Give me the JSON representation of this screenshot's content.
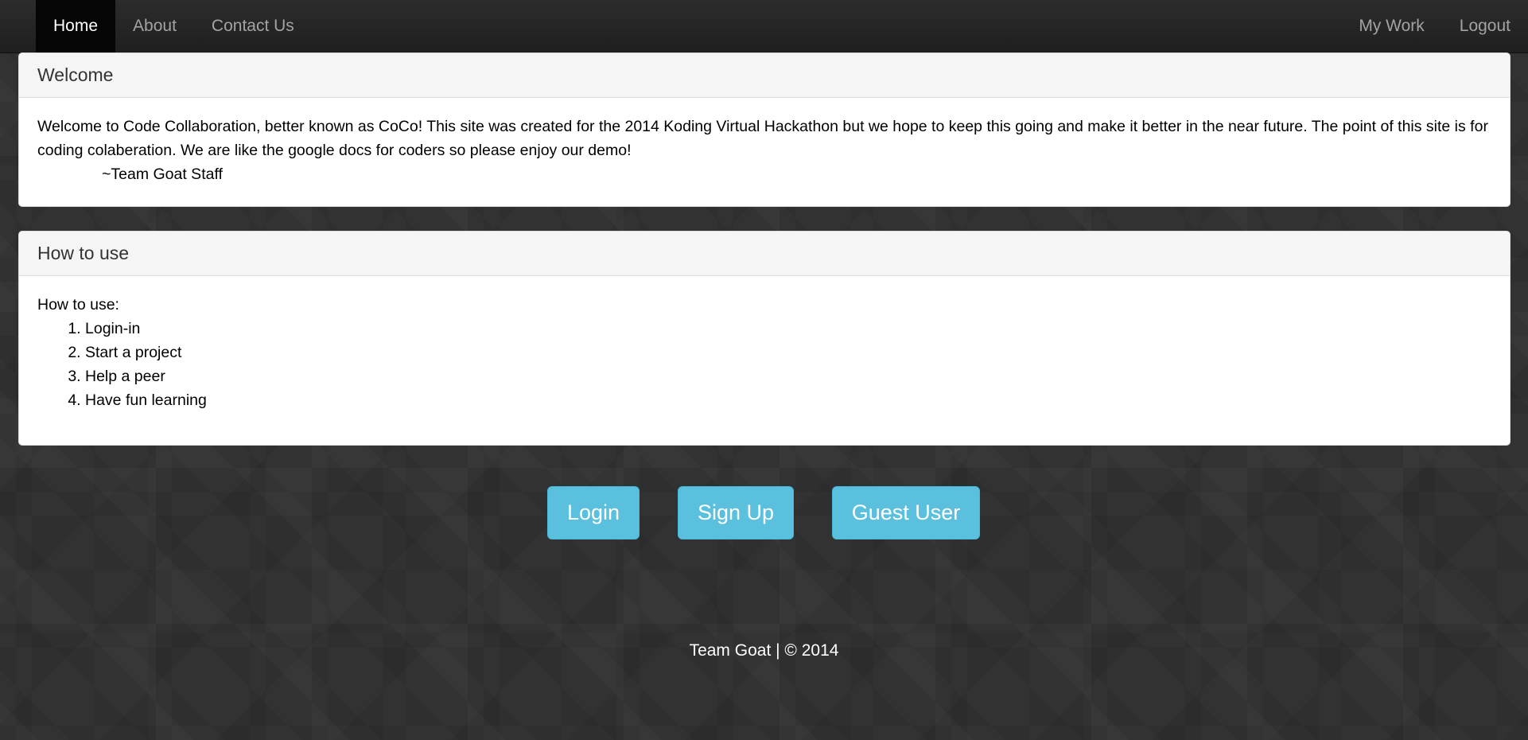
{
  "nav": {
    "left_items": [
      {
        "label": "Home",
        "active": true
      },
      {
        "label": "About",
        "active": false
      },
      {
        "label": "Contact Us",
        "active": false
      }
    ],
    "right_items": [
      {
        "label": "My Work"
      },
      {
        "label": "Logout"
      }
    ]
  },
  "welcome_panel": {
    "title": "Welcome",
    "body": "Welcome to Code Collaboration, better known as CoCo! This site was created for the 2014 Koding Virtual Hackathon but we hope to keep this going and make it better in the near future. The point of this site is for coding colaberation. We are like the google docs for coders so please enjoy our demo!",
    "signature": "~Team Goat Staff"
  },
  "howto_panel": {
    "title": "How to use",
    "intro": "How to use:",
    "steps": [
      "Login-in",
      "Start a project",
      "Help a peer",
      "Have fun learning"
    ]
  },
  "buttons": {
    "login": "Login",
    "signup": "Sign Up",
    "guest": "Guest User"
  },
  "footer": {
    "text": "Team Goat | © 2014"
  },
  "colors": {
    "button_info": "#5bc0de",
    "navbar": "#222222",
    "page_background": "#323232"
  }
}
